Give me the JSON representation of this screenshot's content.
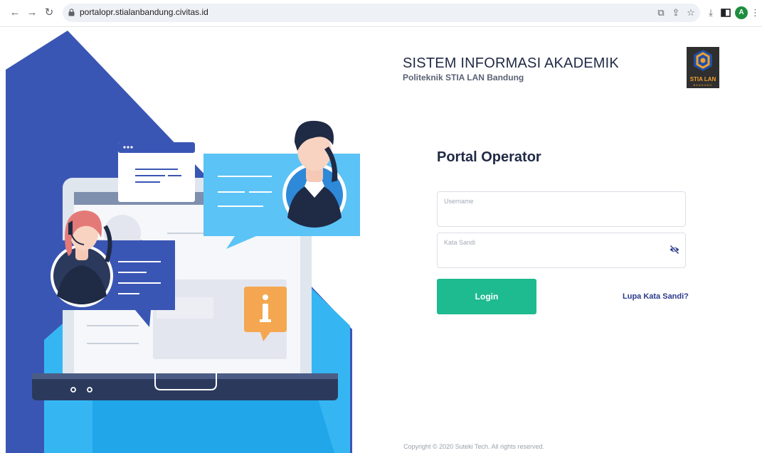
{
  "browser": {
    "url": "portalopr.stialanbandung.civitas.id",
    "profile_initial": "A",
    "icons": [
      "back-icon",
      "forward-icon",
      "reload-icon",
      "lock-icon",
      "cast-icon",
      "share-icon",
      "star-icon",
      "download-icon",
      "side-panel-icon",
      "menu-icon"
    ]
  },
  "header": {
    "title": "SISTEM INFORMASI AKADEMIK",
    "subtitle": "Politeknik STIA LAN Bandung",
    "logo_text": "STIA LAN",
    "logo_subtext": "BANDUNG"
  },
  "login": {
    "title": "Portal Operator",
    "username_label": "Username",
    "password_label": "Kata Sandi",
    "login_button": "Login",
    "forgot_link": "Lupa Kata Sandi?"
  },
  "footer": {
    "copyright": "Copyright © 2020 Suteki Tech. All rights reserved."
  },
  "colors": {
    "accent_green": "#1dbb8f",
    "link_blue": "#2a3a8c",
    "illustration_navy": "#3a56b4",
    "illustration_sky": "#35b6f3"
  }
}
